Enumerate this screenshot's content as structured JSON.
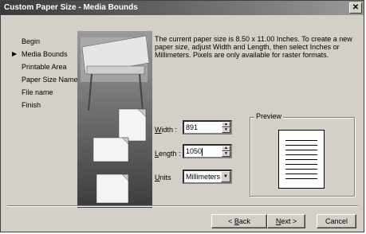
{
  "window": {
    "title": "Custom Paper Size - Media Bounds",
    "close_glyph": "✕"
  },
  "steps": [
    {
      "label": "Begin",
      "current": false
    },
    {
      "label": "Media Bounds",
      "current": true
    },
    {
      "label": "Printable Area",
      "current": false
    },
    {
      "label": "Paper Size Name",
      "current": false
    },
    {
      "label": "File name",
      "current": false
    },
    {
      "label": "Finish",
      "current": false
    }
  ],
  "step_marker": "▶",
  "description": "The current paper size is 8.50 x 11.00 Inches. To create a new paper size, adjust Width and Length, then select Inches or Millimeters. Pixels are only available for raster formats.",
  "fields": {
    "width": {
      "label_u": "W",
      "label_rest": "idth :",
      "value": "891"
    },
    "length": {
      "label_u": "L",
      "label_rest": "ength :",
      "value": "1050"
    },
    "units": {
      "label_u": "U",
      "label_rest": "nits",
      "value": "Millimeters"
    }
  },
  "preview": {
    "label": "Preview",
    "line_count": 9
  },
  "buttons": {
    "back": {
      "prefix": "< ",
      "u": "B",
      "rest": "ack"
    },
    "next": {
      "u": "N",
      "rest": "ext >"
    },
    "cancel": "Cancel"
  },
  "colors": {
    "face": "#d4d0c8",
    "title_start": "#3a3a3a",
    "title_end": "#9a9a9a"
  },
  "icons": {
    "close": "close-icon",
    "spin_up": "spin-up-icon",
    "spin_down": "spin-down-icon",
    "dropdown": "chevron-down-icon",
    "marker": "current-step-arrow-icon"
  }
}
